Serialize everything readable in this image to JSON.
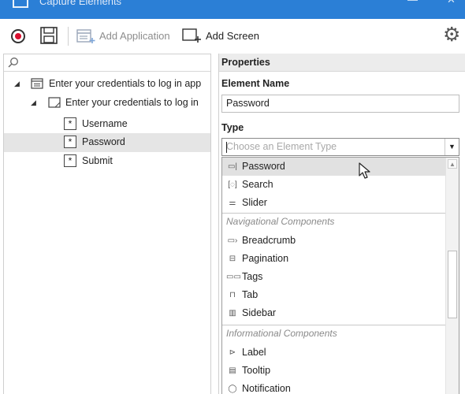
{
  "window": {
    "title": "Capture Elements"
  },
  "toolbar": {
    "add_application_label": "Add Application",
    "add_screen_label": "Add Screen"
  },
  "tree": {
    "application": "Enter your credentials to log in app",
    "screen": "Enter your credentials to log in",
    "elements": [
      "Username",
      "Password",
      "Submit"
    ],
    "selected": "Password"
  },
  "properties": {
    "header": "Properties",
    "element_name_label": "Element Name",
    "element_name_value": "Password",
    "type_label": "Type",
    "type_placeholder": "Choose an Element Type"
  },
  "dropdown": {
    "highlighted": "Password",
    "items_top": [
      "Password",
      "Search",
      "Slider"
    ],
    "group_navigational": "Navigational Components",
    "items_navigational": [
      "Breadcrumb",
      "Pagination",
      "Tags",
      "Tab",
      "Sidebar"
    ],
    "group_informational": "Informational Components",
    "items_informational": [
      "Label",
      "Tooltip",
      "Notification"
    ]
  },
  "colors": {
    "titlebar": "#2b7fd6",
    "record_red": "#d90f2f",
    "selection_gray": "#e5e5e5"
  }
}
